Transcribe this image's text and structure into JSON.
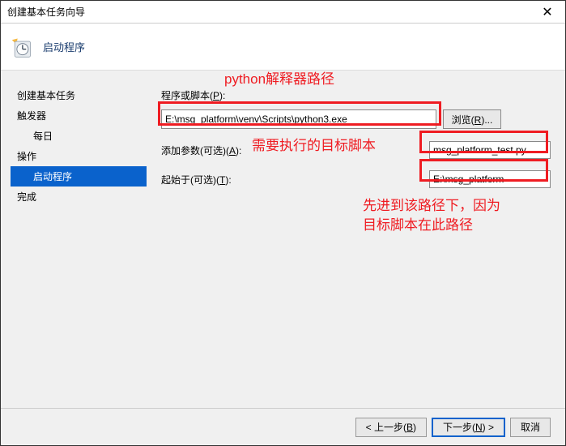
{
  "titlebar": {
    "title": "创建基本任务向导"
  },
  "header": {
    "title": "启动程序"
  },
  "sidebar": {
    "items": [
      {
        "label": "创建基本任务",
        "sub": false,
        "active": false
      },
      {
        "label": "触发器",
        "sub": false,
        "active": false
      },
      {
        "label": "每日",
        "sub": true,
        "active": false
      },
      {
        "label": "操作",
        "sub": false,
        "active": false
      },
      {
        "label": "启动程序",
        "sub": true,
        "active": true
      },
      {
        "label": "完成",
        "sub": false,
        "active": false
      }
    ]
  },
  "form": {
    "script_label_pre": "程序或脚本(",
    "script_label_u": "P",
    "script_label_post": "):",
    "script_value": "E:\\msg_platform\\venv\\Scripts\\python3.exe",
    "browse_pre": "浏览(",
    "browse_u": "R",
    "browse_post": ")...",
    "args_label_pre": "添加参数(可选)(",
    "args_label_u": "A",
    "args_label_post": "):",
    "args_value": "msg_platform_test.py",
    "startin_label_pre": "起始于(可选)(",
    "startin_label_u": "T",
    "startin_label_post": "):",
    "startin_value": "E:\\msg_platform"
  },
  "annotations": {
    "interpreter": "python解释器路径",
    "target_script": "需要执行的目标脚本",
    "path_note_l1": "先进到该路径下，因为",
    "path_note_l2": "目标脚本在此路径"
  },
  "footer": {
    "back_pre": "< 上一步(",
    "back_u": "B",
    "back_post": ")",
    "next_pre": "下一步(",
    "next_u": "N",
    "next_post": ") >",
    "cancel": "取消"
  }
}
